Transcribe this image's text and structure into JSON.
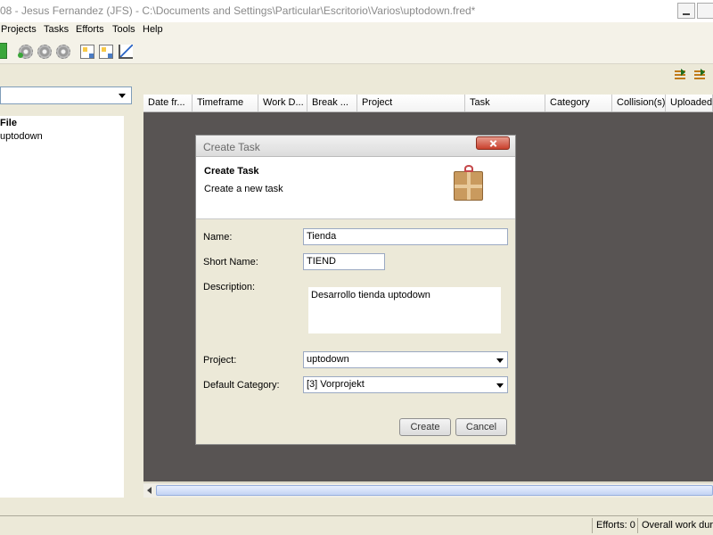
{
  "window": {
    "title": "08 - Jesus Fernandez (JFS) - C:\\Documents and Settings\\Particular\\Escritorio\\Varios\\uptodown.fred*"
  },
  "menu": [
    "Projects",
    "Tasks",
    "Efforts",
    "Tools",
    "Help"
  ],
  "toolbar": {
    "icons": [
      "gear-green-icon",
      "gear-icon",
      "gear-icon",
      "hierarchy-icon",
      "hierarchy-icon",
      "chart-icon"
    ]
  },
  "left_panel": {
    "combo_value": "",
    "tree": {
      "root": "File",
      "child": "uptodown"
    }
  },
  "table": {
    "columns": [
      "Date fr...",
      "Timeframe",
      "Work D...",
      "Break ...",
      "Project",
      "Task",
      "Category",
      "Collision(s)",
      "Uploaded"
    ]
  },
  "status": {
    "efforts": "Efforts: 0",
    "overall": "Overall work durati"
  },
  "dialog": {
    "title": "Create Task",
    "header_title": "Create Task",
    "header_subtitle": "Create a new task",
    "fields": {
      "name_label": "Name:",
      "name_value": "Tienda",
      "short_label": "Short Name:",
      "short_value": "TIEND",
      "desc_label": "Description:",
      "desc_value": "Desarrollo tienda uptodown",
      "project_label": "Project:",
      "project_value": "uptodown",
      "category_label": "Default Category:",
      "category_value": "[3] Vorprojekt"
    },
    "buttons": {
      "create": "Create",
      "cancel": "Cancel"
    }
  }
}
